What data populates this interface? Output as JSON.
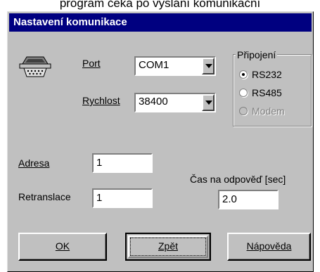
{
  "background_caption": "program čeká po vyslání komunikační",
  "dialog": {
    "title": "Nastavení komunikace",
    "port_label": "Port",
    "port_value": "COM1",
    "speed_label": "Rychlost",
    "speed_value": "38400",
    "connection_group_title": "Připojení",
    "connection_options": [
      {
        "label": "RS232",
        "selected": true,
        "enabled": true
      },
      {
        "label": "RS485",
        "selected": false,
        "enabled": true
      },
      {
        "label": "Modem",
        "selected": false,
        "enabled": false
      }
    ],
    "address_label": "Adresa",
    "address_value": "1",
    "retranslation_label": "Retranslace",
    "retranslation_value": "1",
    "timeout_label": "Čas na odpověď [sec]",
    "timeout_value": "2.0",
    "buttons": {
      "ok": "OK",
      "back": "Zpět",
      "help": "Nápověda"
    }
  }
}
